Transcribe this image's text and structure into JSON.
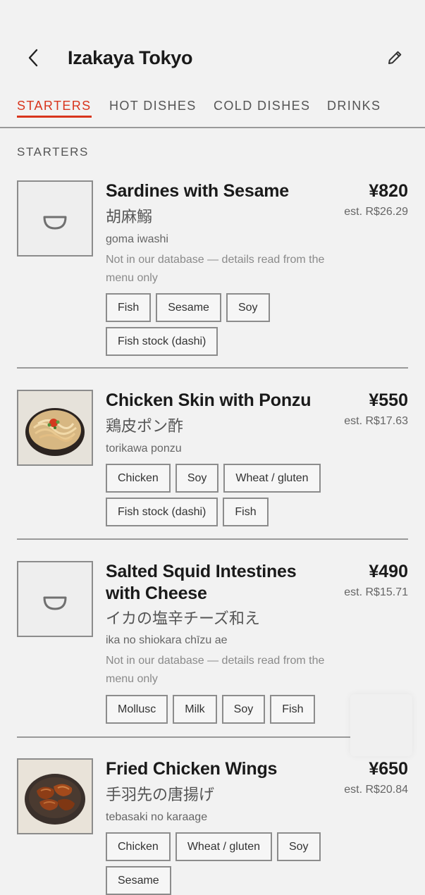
{
  "header": {
    "title": "Izakaya Tokyo"
  },
  "tabs": [
    {
      "label": "STARTERS",
      "active": true
    },
    {
      "label": "HOT DISHES",
      "active": false
    },
    {
      "label": "COLD DISHES",
      "active": false
    },
    {
      "label": "DRINKS",
      "active": false
    }
  ],
  "section": {
    "label": "STARTERS"
  },
  "colors": {
    "accent": "#d8351d",
    "border": "#8c8c8c",
    "background": "#f2f2f2"
  },
  "dishes": [
    {
      "name": "Sardines with Sesame",
      "price": "¥820",
      "est": "est. R$26.29",
      "jp": "胡麻鰯",
      "romaji": "goma iwashi",
      "note": "Not in our database — details read from the menu only",
      "image": "placeholder-bowl-icon",
      "tags": [
        "Fish",
        "Sesame",
        "Soy",
        "Fish stock (dashi)"
      ]
    },
    {
      "name": "Chicken Skin with Ponzu",
      "price": "¥550",
      "est": "est. R$17.63",
      "jp": "鶏皮ポン酢",
      "romaji": "torikawa ponzu",
      "image": "noodle-bowl-photo",
      "tags": [
        "Chicken",
        "Soy",
        "Wheat / gluten",
        "Fish stock (dashi)",
        "Fish"
      ]
    },
    {
      "name": "Salted Squid Intestines with Cheese",
      "price": "¥490",
      "est": "est. R$15.71",
      "jp": "イカの塩辛チーズ和え",
      "romaji": "ika no shiokara chīzu ae",
      "note": "Not in our database — details read from the menu only",
      "image": "placeholder-bowl-icon",
      "tags": [
        "Mollusc",
        "Milk",
        "Soy",
        "Fish"
      ]
    },
    {
      "name": "Fried Chicken Wings",
      "price": "¥650",
      "est": "est. R$20.84",
      "jp": "手羽先の唐揚げ",
      "romaji": "tebasaki no karaage",
      "image": "chicken-wings-photo",
      "tags": [
        "Chicken",
        "Wheat / gluten",
        "Soy",
        "Sesame"
      ]
    }
  ]
}
